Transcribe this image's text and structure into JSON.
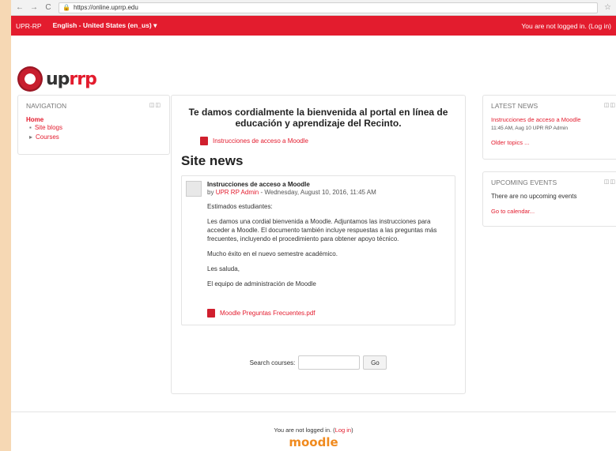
{
  "browser": {
    "url": "https://online.uprrp.edu",
    "back": "←",
    "forward": "→",
    "reload": "C",
    "lock": "🔒",
    "star": "☆"
  },
  "topbar": {
    "brand": "UPR-RP",
    "language": "English - United States (en_us) ▾",
    "login_status": "You are not logged in. (Log in)"
  },
  "logo": {
    "word_left": "up",
    "word_right": "rrp"
  },
  "navigation": {
    "title": "NAVIGATION",
    "controls": "◫◫",
    "home": "Home",
    "items": [
      {
        "bullet": "▪",
        "label": "Site blogs"
      },
      {
        "bullet": "▸",
        "label": "Courses"
      }
    ]
  },
  "main": {
    "welcome": "Te damos cordialmente la bienvenida al portal en línea de educación y aprendizaje del Recinto.",
    "access_link": "Instrucciones de acceso a Moodle",
    "site_news": "Site news",
    "post": {
      "subject": "Instrucciones de acceso a Moodle",
      "by_prefix": "by",
      "author": "UPR RP Admin",
      "date_suffix": " - Wednesday, August 10, 2016, 11:45 AM",
      "paragraphs": [
        "Estimados estudiantes:",
        "Les damos una cordial bienvenida a Moodle. Adjuntamos las instrucciones para acceder a Moodle. El documento también incluye respuestas a las preguntas más frecuentes, incluyendo el procedimiento para obtener apoyo técnico.",
        "Mucho éxito en el nuevo semestre académico.",
        "Les saluda,",
        "El equipo de administración de Moodle"
      ],
      "attachment": "Moodle Preguntas Frecuentes.pdf"
    },
    "search_label": "Search courses:",
    "search_value": "",
    "search_button": "Go"
  },
  "latest_news": {
    "title": "LATEST NEWS",
    "controls": "◫◫",
    "link": "Instrucciones de acceso a Moodle",
    "meta": "11:45 AM, Aug 10  UPR RP Admin",
    "older": "Older topics ..."
  },
  "upcoming": {
    "title": "UPCOMING EVENTS",
    "controls": "◫◫",
    "none": "There are no upcoming events",
    "calendar": "Go to calendar..."
  },
  "footer": {
    "prefix": "You are not logged in. (",
    "login": "Log in",
    "suffix": ")",
    "logo": "moodle"
  }
}
